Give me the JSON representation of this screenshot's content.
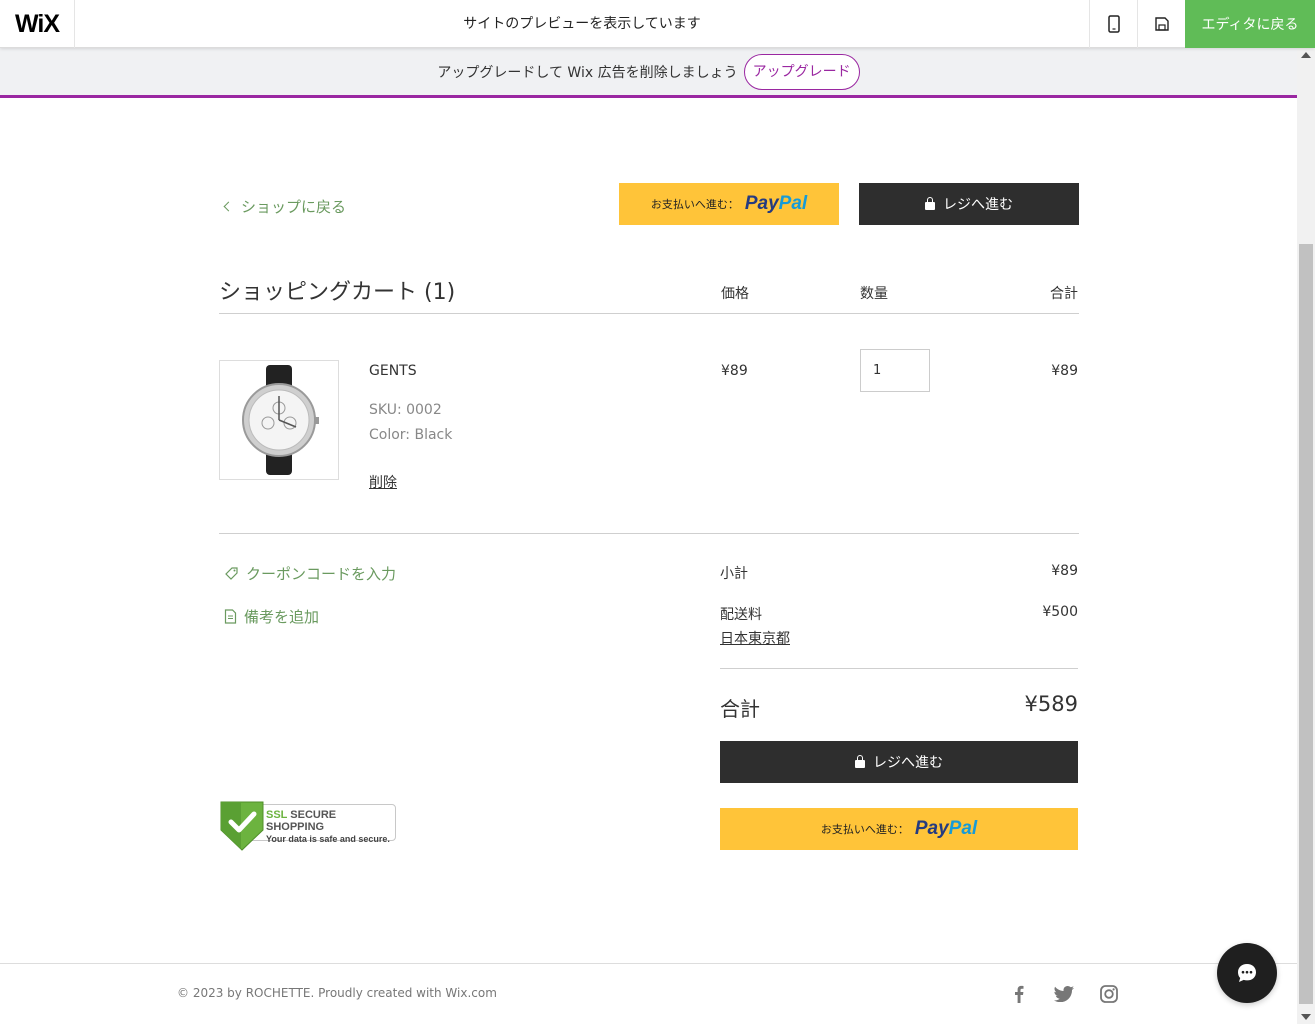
{
  "topbar": {
    "logo": "WiX",
    "preview_text": "サイトのプレビューを表示しています",
    "mobile_icon": "mobile-icon",
    "save_icon": "save-icon",
    "editor_button": "エディタに戻る"
  },
  "upgrade_banner": {
    "text": "アップグレードして Wix 広告を削除しましょう",
    "button": "アップグレード",
    "accent_color": "#9a27a1"
  },
  "cart": {
    "back_link": "ショップに戻る",
    "paypal_label": "お支払いへ進む：",
    "paypal_logo_1": "Pay",
    "paypal_logo_2": "Pal",
    "checkout_button": "レジへ進む",
    "title": "ショッピングカート (1)",
    "col_price": "価格",
    "col_qty": "数量",
    "col_total": "合計",
    "item": {
      "name": "GENTS",
      "sku": "SKU: 0002",
      "color": "Color: Black",
      "remove": "削除",
      "price": "¥89",
      "quantity": "1",
      "total": "¥89"
    },
    "coupon_link": "クーポンコードを入力",
    "note_link": "備考を追加",
    "subtotal_label": "小計",
    "subtotal_value": "¥89",
    "shipping_label": "配送料",
    "shipping_value": "¥500",
    "shipping_location": "日本東京都",
    "total_label": "合計",
    "total_value": "¥589"
  },
  "ssl_badge": {
    "ssl": "SSL",
    "secure": "SECURE SHOPPING",
    "subtitle": "Your data is safe and secure."
  },
  "footer": {
    "copyright": "© 2023 by ROCHETTE. Proudly created with Wix.com"
  },
  "colors": {
    "wix_green": "#60bc57",
    "link_green": "#6a9a5f",
    "paypal_yellow": "#ffc439",
    "checkout_dark": "#2e2e2e"
  }
}
